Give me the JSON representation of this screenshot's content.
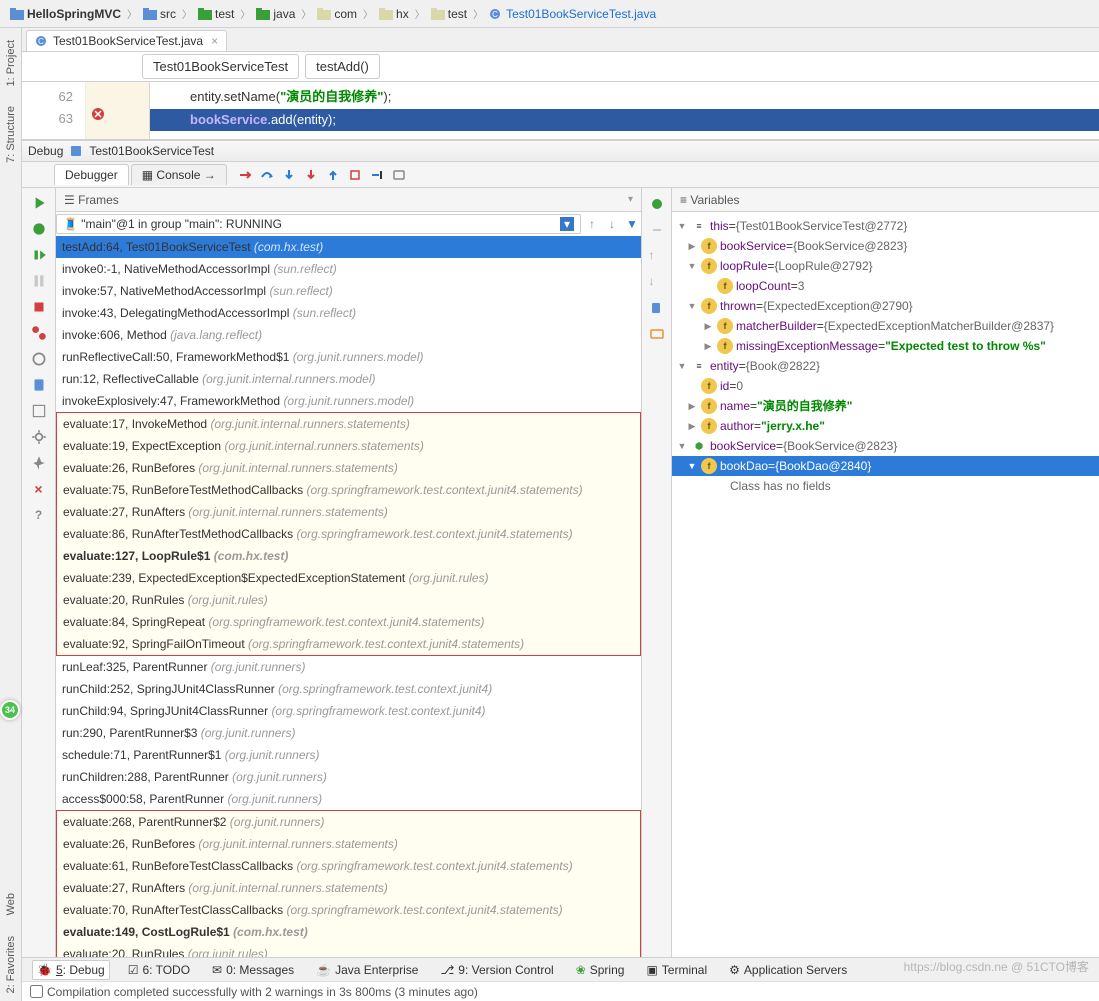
{
  "breadcrumb": [
    {
      "label": "HelloSpringMVC",
      "bold": true,
      "type": "project"
    },
    {
      "label": "src",
      "type": "src"
    },
    {
      "label": "test",
      "type": "test"
    },
    {
      "label": "java",
      "type": "src"
    },
    {
      "label": "com",
      "type": "pkg"
    },
    {
      "label": "hx",
      "type": "pkg"
    },
    {
      "label": "test",
      "type": "pkg"
    },
    {
      "label": "Test01BookServiceTest.java",
      "type": "class",
      "class": true
    }
  ],
  "editorTab": "Test01BookServiceTest.java",
  "classNav": {
    "class": "Test01BookServiceTest",
    "method": "testAdd()"
  },
  "gutter": [
    "62",
    "63"
  ],
  "code": {
    "line62": {
      "prefix": "entity.setName(",
      "str": "\"演员的自我修养\"",
      "suffix": ");"
    },
    "line63": {
      "obj": "bookService",
      "call": ".add(entity);"
    }
  },
  "debugTitle": "Test01BookServiceTest",
  "tabs": {
    "debugger": "Debugger",
    "console": "Console"
  },
  "thread": "\"main\"@1 in group \"main\": RUNNING",
  "frames": [
    {
      "main": "testAdd:64, Test01BookServiceTest ",
      "pkg": "(com.hx.test)",
      "sel": true
    },
    {
      "main": "invoke0:-1, NativeMethodAccessorImpl ",
      "pkg": "(sun.reflect)"
    },
    {
      "main": "invoke:57, NativeMethodAccessorImpl ",
      "pkg": "(sun.reflect)"
    },
    {
      "main": "invoke:43, DelegatingMethodAccessorImpl ",
      "pkg": "(sun.reflect)"
    },
    {
      "main": "invoke:606, Method ",
      "pkg": "(java.lang.reflect)"
    },
    {
      "main": "runReflectiveCall:50, FrameworkMethod$1 ",
      "pkg": "(org.junit.runners.model)"
    },
    {
      "main": "run:12, ReflectiveCallable ",
      "pkg": "(org.junit.internal.runners.model)"
    },
    {
      "main": "invokeExplosively:47, FrameworkMethod ",
      "pkg": "(org.junit.runners.model)"
    }
  ],
  "framesBox1": [
    {
      "main": "evaluate:17, InvokeMethod ",
      "pkg": "(org.junit.internal.runners.statements)"
    },
    {
      "main": "evaluate:19, ExpectException ",
      "pkg": "(org.junit.internal.runners.statements)"
    },
    {
      "main": "evaluate:26, RunBefores ",
      "pkg": "(org.junit.internal.runners.statements)"
    },
    {
      "main": "evaluate:75, RunBeforeTestMethodCallbacks ",
      "pkg": "(org.springframework.test.context.junit4.statements)"
    },
    {
      "main": "evaluate:27, RunAfters ",
      "pkg": "(org.junit.internal.runners.statements)"
    },
    {
      "main": "evaluate:86, RunAfterTestMethodCallbacks ",
      "pkg": "(org.springframework.test.context.junit4.statements)"
    },
    {
      "main": "evaluate:127, LoopRule$1 ",
      "pkg": "(com.hx.test)",
      "bold": true
    },
    {
      "main": "evaluate:239, ExpectedException$ExpectedExceptionStatement ",
      "pkg": "(org.junit.rules)"
    },
    {
      "main": "evaluate:20, RunRules ",
      "pkg": "(org.junit.rules)"
    },
    {
      "main": "evaluate:84, SpringRepeat ",
      "pkg": "(org.springframework.test.context.junit4.statements)"
    },
    {
      "main": "evaluate:92, SpringFailOnTimeout ",
      "pkg": "(org.springframework.test.context.junit4.statements)"
    }
  ],
  "framesMid": [
    {
      "main": "runLeaf:325, ParentRunner ",
      "pkg": "(org.junit.runners)"
    },
    {
      "main": "runChild:252, SpringJUnit4ClassRunner ",
      "pkg": "(org.springframework.test.context.junit4)"
    },
    {
      "main": "runChild:94, SpringJUnit4ClassRunner ",
      "pkg": "(org.springframework.test.context.junit4)"
    },
    {
      "main": "run:290, ParentRunner$3 ",
      "pkg": "(org.junit.runners)"
    },
    {
      "main": "schedule:71, ParentRunner$1 ",
      "pkg": "(org.junit.runners)"
    },
    {
      "main": "runChildren:288, ParentRunner ",
      "pkg": "(org.junit.runners)"
    },
    {
      "main": "access$000:58, ParentRunner ",
      "pkg": "(org.junit.runners)"
    }
  ],
  "framesBox2": [
    {
      "main": "evaluate:268, ParentRunner$2 ",
      "pkg": "(org.junit.runners)"
    },
    {
      "main": "evaluate:26, RunBefores ",
      "pkg": "(org.junit.internal.runners.statements)"
    },
    {
      "main": "evaluate:61, RunBeforeTestClassCallbacks ",
      "pkg": "(org.springframework.test.context.junit4.statements)"
    },
    {
      "main": "evaluate:27, RunAfters ",
      "pkg": "(org.junit.internal.runners.statements)"
    },
    {
      "main": "evaluate:70, RunAfterTestClassCallbacks ",
      "pkg": "(org.springframework.test.context.junit4.statements)"
    },
    {
      "main": "evaluate:149, CostLogRule$1 ",
      "pkg": "(com.hx.test)",
      "bold": true
    },
    {
      "main": "evaluate:20, RunRules ",
      "pkg": "(org.junit.rules)"
    }
  ],
  "varsTitle": "Variables",
  "framesTitle": "Frames",
  "vars": {
    "this": {
      "label": "this",
      "val": "{Test01BookServiceTest@2772}"
    },
    "bookService": {
      "label": "bookService",
      "val": "{BookService@2823}"
    },
    "loopRule": {
      "label": "loopRule",
      "val": "{LoopRule@2792}"
    },
    "loopCount": {
      "label": "loopCount",
      "val": "3"
    },
    "thrown": {
      "label": "thrown",
      "val": "{ExpectedException@2790}"
    },
    "matcherBuilder": {
      "label": "matcherBuilder",
      "val": "{ExpectedExceptionMatcherBuilder@2837}"
    },
    "missingExceptionMessage": {
      "label": "missingExceptionMessage",
      "val": "\"Expected test to throw %s\""
    },
    "entity": {
      "label": "entity",
      "val": "{Book@2822}"
    },
    "id": {
      "label": "id",
      "val": "0"
    },
    "name": {
      "label": "name",
      "val": "\"演员的自我修养\""
    },
    "author": {
      "label": "author",
      "val": "\"jerry.x.he\""
    },
    "bookServiceLocal": {
      "label": "bookService",
      "val": "{BookService@2823}"
    },
    "bookDao": {
      "label": "bookDao",
      "val": "{BookDao@2840}"
    },
    "noFields": "Class has no fields"
  },
  "bottomTabs": {
    "debug": "5: Debug",
    "todo": "6: TODO",
    "messages": "0: Messages",
    "javaee": "Java Enterprise",
    "vcs": "9: Version Control",
    "spring": "Spring",
    "terminal": "Terminal",
    "appservers": "Application Servers"
  },
  "status": "Compilation completed successfully with 2 warnings in 3s 800ms (3 minutes ago)",
  "sideTabs": {
    "project": "1: Project",
    "structure": "7: Structure",
    "web": "Web",
    "favorites": "2: Favorites"
  },
  "greenBadge": "34",
  "watermark": "https://blog.csdn.ne @ 51CTO博客"
}
